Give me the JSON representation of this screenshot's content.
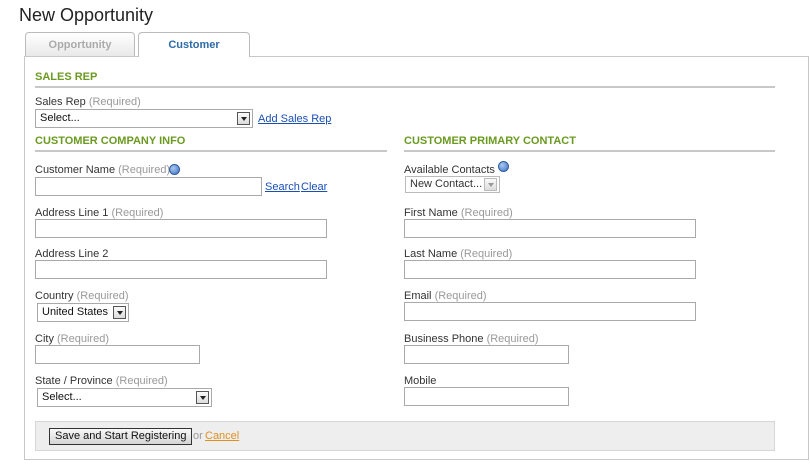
{
  "page": {
    "title": "New Opportunity"
  },
  "tabs": [
    {
      "label": "Opportunity",
      "active": false
    },
    {
      "label": "Customer",
      "active": true
    }
  ],
  "required_suffix": "(Required)",
  "sales_rep_section": {
    "heading": "SALES REP",
    "field_label": "Sales Rep",
    "select_value": "Select...",
    "add_link": "Add Sales Rep"
  },
  "company_section": {
    "heading": "CUSTOMER COMPANY INFO",
    "customer_name_label": "Customer Name",
    "search_link": "Search",
    "clear_link": "Clear",
    "address1_label": "Address Line 1",
    "address2_label": "Address Line 2",
    "country_label": "Country",
    "country_value": "United States",
    "city_label": "City",
    "state_label": "State / Province",
    "state_value": "Select..."
  },
  "contact_section": {
    "heading": "CUSTOMER PRIMARY CONTACT",
    "available_contacts_label": "Available Contacts",
    "available_contacts_value": "New Contact...",
    "first_name_label": "First Name",
    "last_name_label": "Last Name",
    "email_label": "Email",
    "business_phone_label": "Business Phone",
    "mobile_label": "Mobile"
  },
  "footer": {
    "submit_label": "Save and Start Registering",
    "or_text": "or",
    "cancel_label": "Cancel"
  },
  "colors": {
    "section_heading": "#6a9a1f",
    "link": "#1a4fb5",
    "cancel_link": "#e0901f",
    "active_tab_text": "#2c6aa8"
  }
}
